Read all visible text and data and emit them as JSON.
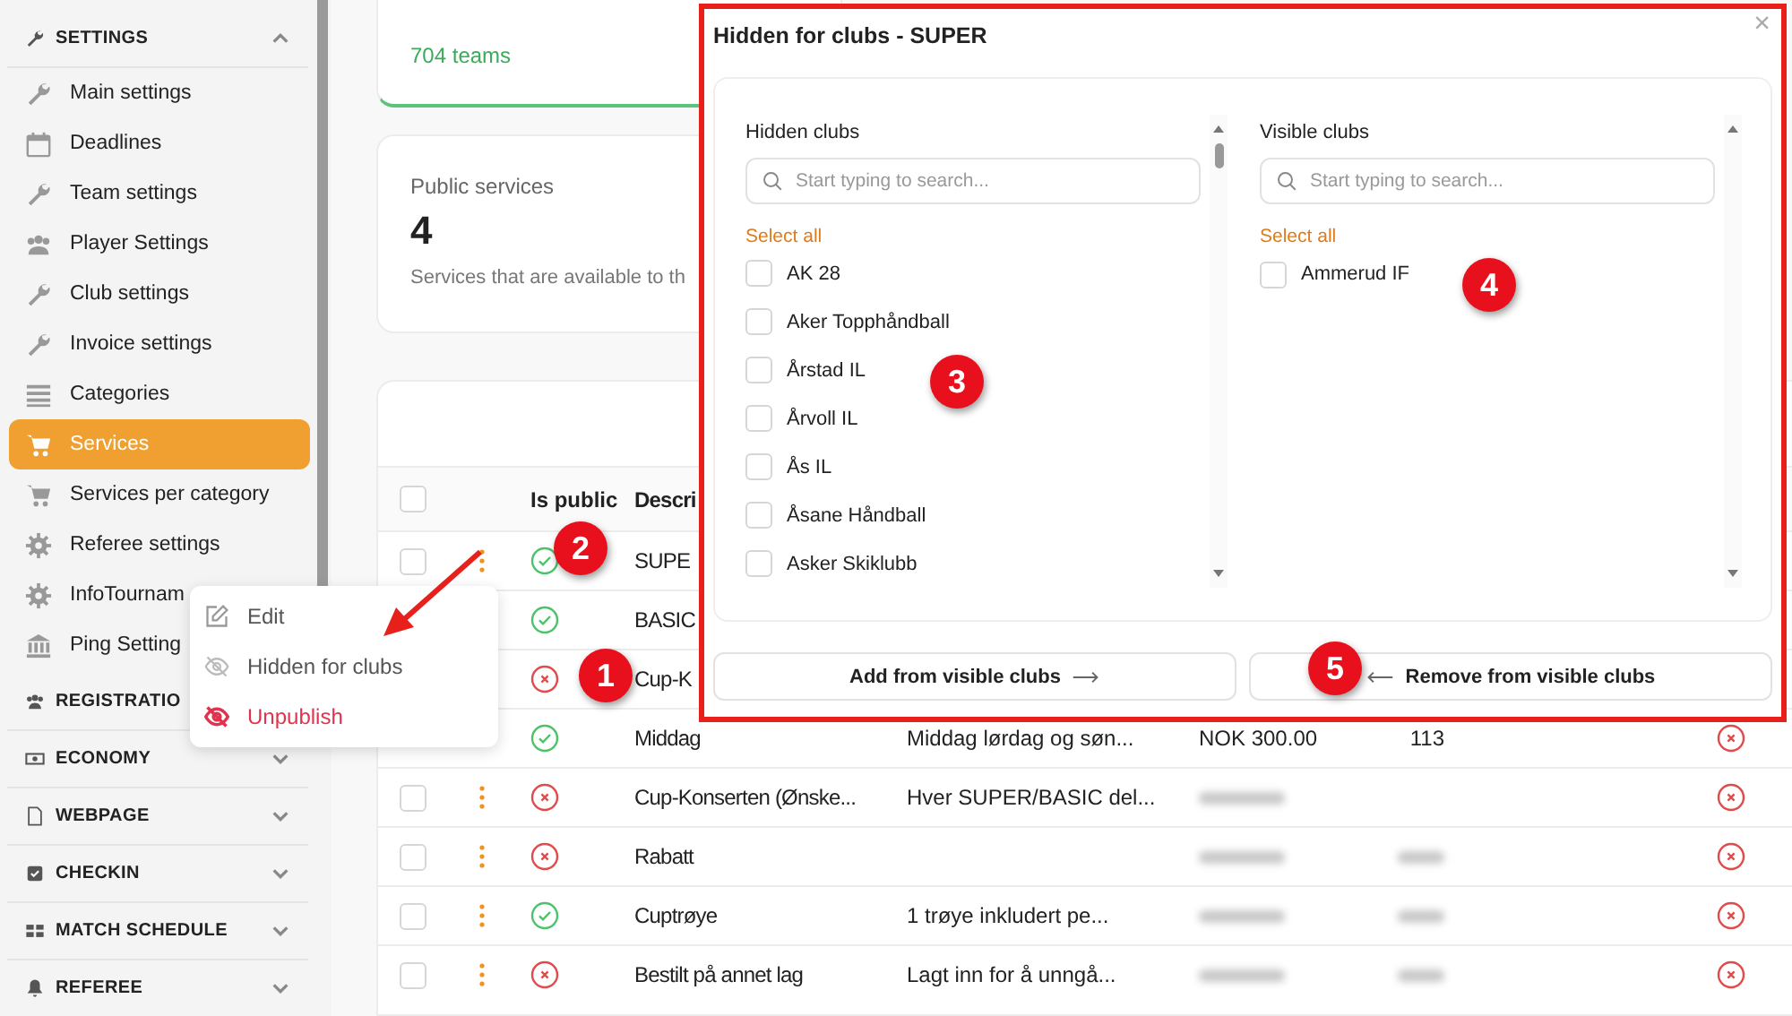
{
  "sidebar": {
    "sections": [
      {
        "label": "SETTINGS",
        "kind": "wrench",
        "expanded": true,
        "items": [
          {
            "label": "Main settings",
            "kind": "wrench",
            "selected": false
          },
          {
            "label": "Deadlines",
            "kind": "calendar",
            "selected": false
          },
          {
            "label": "Team settings",
            "kind": "wrench",
            "selected": false
          },
          {
            "label": "Player Settings",
            "kind": "users",
            "selected": false
          },
          {
            "label": "Club settings",
            "kind": "wrench",
            "selected": false
          },
          {
            "label": "Invoice settings",
            "kind": "wrench",
            "selected": false
          },
          {
            "label": "Categories",
            "kind": "list",
            "selected": false
          },
          {
            "label": "Services",
            "kind": "cart",
            "selected": true
          },
          {
            "label": "Services per category",
            "kind": "cart",
            "selected": false
          },
          {
            "label": "Referee settings",
            "kind": "gear",
            "selected": false
          },
          {
            "label": "InfoTournam",
            "kind": "gear",
            "selected": false
          },
          {
            "label": "Ping Setting",
            "kind": "bank",
            "selected": false
          }
        ]
      },
      {
        "label": "REGISTRATIO",
        "kind": "users"
      },
      {
        "label": "ECONOMY",
        "kind": "money",
        "expanded": false
      },
      {
        "label": "WEBPAGE",
        "kind": "file",
        "expanded": false
      },
      {
        "label": "CHECKIN",
        "kind": "check",
        "expanded": false
      },
      {
        "label": "MATCH SCHEDULE",
        "kind": "grid",
        "expanded": false
      },
      {
        "label": "REFEREE",
        "kind": "bell",
        "expanded": false
      }
    ]
  },
  "stats": [
    {
      "note": "704 teams"
    },
    {
      "title": "Public services",
      "value": "4",
      "note": "Services that are available to th"
    }
  ],
  "table": {
    "header_checked": false,
    "columns": [
      "Is public",
      "Descri"
    ],
    "rows": [
      {
        "checked": false,
        "actions": true,
        "public": true,
        "name": "SUPE"
      },
      {
        "public": true,
        "name": "BASIC"
      },
      {
        "public": false,
        "name": "Cup-K"
      },
      {
        "public": true,
        "name": "Middag",
        "description": "Middag lørdag og søn...",
        "price": "NOK 300.00",
        "count": "113",
        "active": false
      },
      {
        "checked": false,
        "actions": true,
        "public": false,
        "name": "Cup-Konserten (Ønske...",
        "description": "Hver SUPER/BASIC del...",
        "price_hidden": true,
        "count_hidden": false,
        "active": false
      },
      {
        "checked": false,
        "actions": true,
        "public": false,
        "name": "Rabatt",
        "price_hidden": true,
        "count_hidden": true,
        "active": false
      },
      {
        "checked": false,
        "actions": true,
        "public": true,
        "name": "Cuptrøye",
        "description": "1 trøye inkludert pe...",
        "price_hidden": true,
        "count_hidden": true,
        "active": false
      },
      {
        "checked": false,
        "actions": true,
        "public": false,
        "name": "Bestilt på annet lag",
        "description": "Lagt inn for å unngå...",
        "price_hidden": true,
        "count_hidden": true,
        "active": false
      }
    ]
  },
  "context_menu": {
    "items": [
      {
        "label": "Edit",
        "kind": "edit"
      },
      {
        "label": "Hidden for clubs",
        "kind": "hidden"
      },
      {
        "label": "Unpublish",
        "kind": "danger"
      }
    ]
  },
  "modal": {
    "title": "Hidden for clubs - SUPER",
    "close": "×",
    "lists": [
      {
        "title": "Hidden clubs",
        "placeholder": "Start typing to search...",
        "select_all": "Select all",
        "items": [
          {
            "label": "AK 28",
            "checked": false
          },
          {
            "label": "Aker Topphåndball",
            "checked": false
          },
          {
            "label": "Årstad IL",
            "checked": false
          },
          {
            "label": "Årvoll IL",
            "checked": false
          },
          {
            "label": "Ås IL",
            "checked": false
          },
          {
            "label": "Åsane Håndball",
            "checked": false
          },
          {
            "label": "Asker Skiklubb",
            "checked": false
          }
        ]
      },
      {
        "title": "Visible clubs",
        "placeholder": "Start typing to search...",
        "select_all": "Select all",
        "items": [
          {
            "label": "Ammerud IF",
            "checked": false
          }
        ]
      }
    ],
    "buttons": [
      {
        "label": "Add from visible clubs",
        "kind": "forward"
      },
      {
        "label": "Remove from visible clubs",
        "kind": "back"
      }
    ]
  },
  "callouts": [
    "1",
    "2",
    "3",
    "4",
    "5"
  ]
}
